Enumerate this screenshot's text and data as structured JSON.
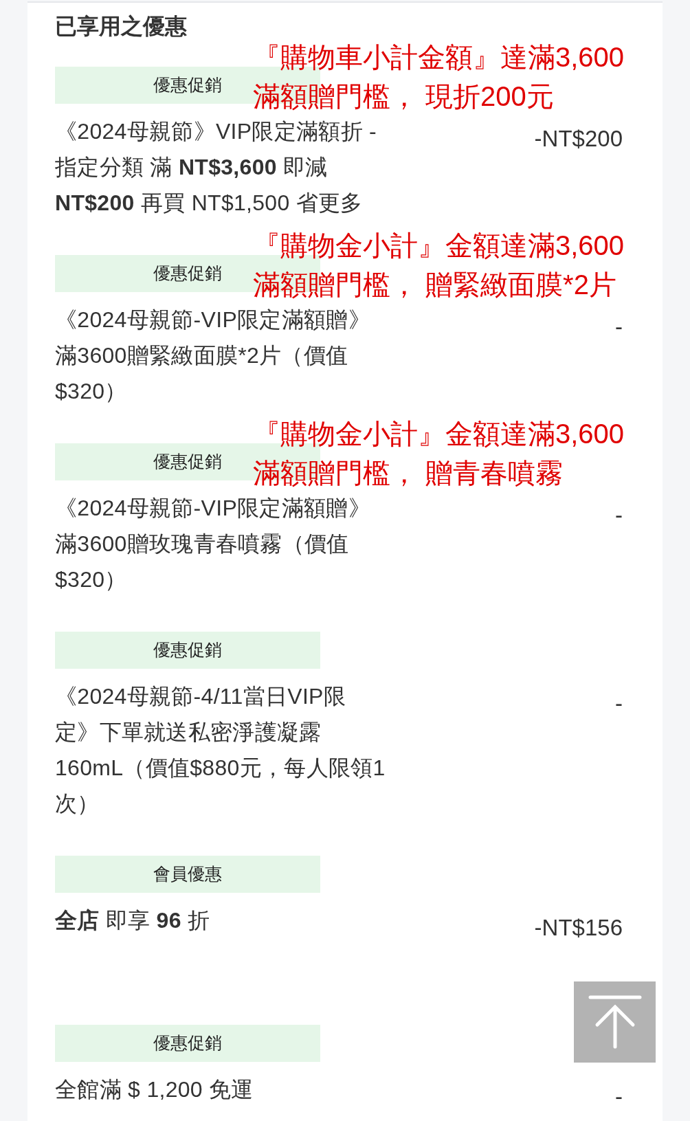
{
  "section_title": "已享用之優惠",
  "discounts": [
    {
      "tag": "優惠促銷",
      "description": "《2024母親節》VIP限定滿額折 - 指定分類 滿 **NT$3,600** 即減 **NT$200** 再買 NT$1,500 省更多",
      "amount": "-NT$200",
      "annotation": [
        "『購物車小計金額』達滿3,600",
        "滿額贈門檻， 現折200元"
      ]
    },
    {
      "tag": "優惠促銷",
      "description": "《2024母親節-VIP限定滿額贈》滿3600贈緊緻面膜*2片（價值$320）",
      "amount": "-",
      "annotation": [
        "『購物金小計』金額達滿3,600",
        "滿額贈門檻， 贈緊緻面膜*2片"
      ]
    },
    {
      "tag": "優惠促銷",
      "description": "《2024母親節-VIP限定滿額贈》滿3600贈玫瑰青春噴霧（價值$320）",
      "amount": "-",
      "annotation": [
        "『購物金小計』金額達滿3,600",
        "滿額贈門檻， 贈青春噴霧"
      ]
    },
    {
      "tag": "優惠促銷",
      "description": "《2024母親節-4/11當日VIP限定》下單就送私密淨護凝露160mL（價值$880元，每人限領1次）",
      "amount": "-"
    },
    {
      "tag": "會員優惠",
      "description": "**全店** 即享 **96** 折",
      "amount": "-NT$156"
    },
    {
      "tag": "優惠促銷",
      "description": "全館滿 $ 1,200 免運",
      "amount": "-"
    }
  ]
}
